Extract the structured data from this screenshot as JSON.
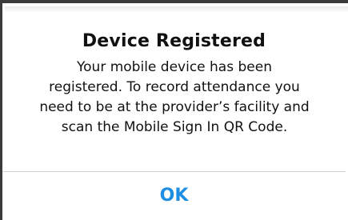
{
  "alert": {
    "title": "Device Registered",
    "message": "Your mobile device has been\nregistered. To record attendance you\nneed to be at the provider’s facility and\nscan the Mobile Sign In QR Code.",
    "ok_label": "OK"
  },
  "colors": {
    "accent": "#1e8ee3",
    "text": "#111111",
    "divider": "#d1d1d6",
    "backdrop_edge": "#3a3a3a"
  }
}
